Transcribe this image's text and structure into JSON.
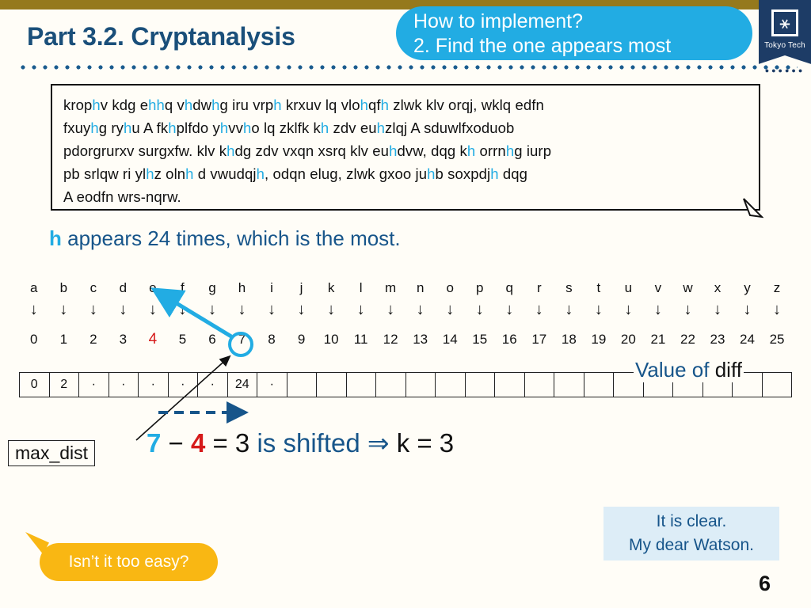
{
  "theme": {
    "accent_blue": "#22ace3",
    "dark_blue": "#17558a",
    "navy": "#1d3c66",
    "gold_bar": "#95791d",
    "red": "#d61a1a",
    "yellow": "#f9b713",
    "page_bg": "#fffdf7"
  },
  "header": {
    "title": "Part 3.2.  Cryptanalysis",
    "callout_line1": "How to implement?",
    "callout_line2": "2. Find the one appears most",
    "logo_text": "Tokyo Tech",
    "logo_dots": "●●●●●●"
  },
  "cipher": {
    "lines": [
      [
        {
          "t": "krop",
          "h": false
        },
        {
          "t": "h",
          "h": true
        },
        {
          "t": "v kdg e",
          "h": false
        },
        {
          "t": "hh",
          "h": true
        },
        {
          "t": "q v",
          "h": false
        },
        {
          "t": "h",
          "h": true
        },
        {
          "t": "dw",
          "h": false
        },
        {
          "t": "h",
          "h": true
        },
        {
          "t": "g iru vrp",
          "h": false
        },
        {
          "t": "h",
          "h": true
        },
        {
          "t": " krxuv lq vlo",
          "h": false
        },
        {
          "t": "h",
          "h": true
        },
        {
          "t": "qf",
          "h": false
        },
        {
          "t": "h",
          "h": true
        },
        {
          "t": " zlwk klv orqj, wklq edfn",
          "h": false
        }
      ],
      [
        {
          "t": "fxuy",
          "h": false
        },
        {
          "t": "h",
          "h": true
        },
        {
          "t": "g ry",
          "h": false
        },
        {
          "t": "h",
          "h": true
        },
        {
          "t": "u A fk",
          "h": false
        },
        {
          "t": "h",
          "h": true
        },
        {
          "t": "plfdo y",
          "h": false
        },
        {
          "t": "h",
          "h": true
        },
        {
          "t": "vv",
          "h": false
        },
        {
          "t": "h",
          "h": true
        },
        {
          "t": "o lq zklfk k",
          "h": false
        },
        {
          "t": "h",
          "h": true
        },
        {
          "t": " zdv eu",
          "h": false
        },
        {
          "t": "h",
          "h": true
        },
        {
          "t": "zlqj A sduwlfxoduob",
          "h": false
        }
      ],
      [
        {
          "t": "pdorgrurxv surgxfw. klv k",
          "h": false
        },
        {
          "t": "h",
          "h": true
        },
        {
          "t": "dg zdv vxqn xsrq klv eu",
          "h": false
        },
        {
          "t": "h",
          "h": true
        },
        {
          "t": "dvw, dqg k",
          "h": false
        },
        {
          "t": "h",
          "h": true
        },
        {
          "t": " orrn",
          "h": false
        },
        {
          "t": "h",
          "h": true
        },
        {
          "t": "g iurp",
          "h": false
        }
      ],
      [
        {
          "t": "pb srlqw ri yl",
          "h": false
        },
        {
          "t": "h",
          "h": true
        },
        {
          "t": "z oln",
          "h": false
        },
        {
          "t": "h",
          "h": true
        },
        {
          "t": " d vwudqj",
          "h": false
        },
        {
          "t": "h",
          "h": true
        },
        {
          "t": ", odqn elug, zlwk gxoo ju",
          "h": false
        },
        {
          "t": "h",
          "h": true
        },
        {
          "t": "b soxpdj",
          "h": false
        },
        {
          "t": "h",
          "h": true
        },
        {
          "t": " dqg",
          "h": false
        }
      ],
      [
        {
          "t": "A eodfn wrs-nqrw.",
          "h": false
        }
      ]
    ],
    "plain_text": "krophv kdg ehhq vhdwhg iru vrph krxuv lq vlohqfh zlwk klv orqj, wklq edfn fxuyhg ryhu A fkhplfdo yhvvho lq zklfk kh zdv euhzlqj A sduwlfxoduob pdorgrurxv surgxfw. klv khdg zdv vxqn xsrq klv euhdvw, dqg kh orrnhg iurp pb srlqw ri ylhz olnh d vwudqjh, odqn elug, zlwk gxoo juhb soxpdjh dqg A eodfn wrs-nqrw."
  },
  "statement": {
    "letter": "h",
    "rest": " appears 24 times, which is the most."
  },
  "alphabet": {
    "letters": [
      "a",
      "b",
      "c",
      "d",
      "e",
      "f",
      "g",
      "h",
      "i",
      "j",
      "k",
      "l",
      "m",
      "n",
      "o",
      "p",
      "q",
      "r",
      "s",
      "t",
      "u",
      "v",
      "w",
      "x",
      "y",
      "z"
    ],
    "arrow": "↓",
    "numbers": [
      "0",
      "1",
      "2",
      "3",
      "4",
      "5",
      "6",
      "7",
      "8",
      "9",
      "10",
      "11",
      "12",
      "13",
      "14",
      "15",
      "16",
      "17",
      "18",
      "19",
      "20",
      "21",
      "22",
      "23",
      "24",
      "25"
    ],
    "highlight_red_index": 4,
    "circled_index": 7
  },
  "diff_table": {
    "cells": [
      "0",
      "2",
      "·",
      "·",
      "·",
      "·",
      "·",
      "24",
      "·",
      "",
      "",
      "",
      "",
      "",
      "",
      "",
      "",
      "",
      "",
      "",
      "",
      "",
      "",
      "",
      "",
      ""
    ],
    "label_blue": "Value of ",
    "label_black": "diff"
  },
  "annotations": {
    "max_dist": "max_dist"
  },
  "equation": {
    "a": "7",
    "minus": " − ",
    "b": "4",
    "equals": " = 3 ",
    "shifted": "is shifted ",
    "implies": "⇒ ",
    "result": "k = 3"
  },
  "bottom": {
    "easy_bubble": "Isn’t it too easy?",
    "watson_line1": "It is clear.",
    "watson_line2": "My dear Watson.",
    "page_number": "6"
  }
}
